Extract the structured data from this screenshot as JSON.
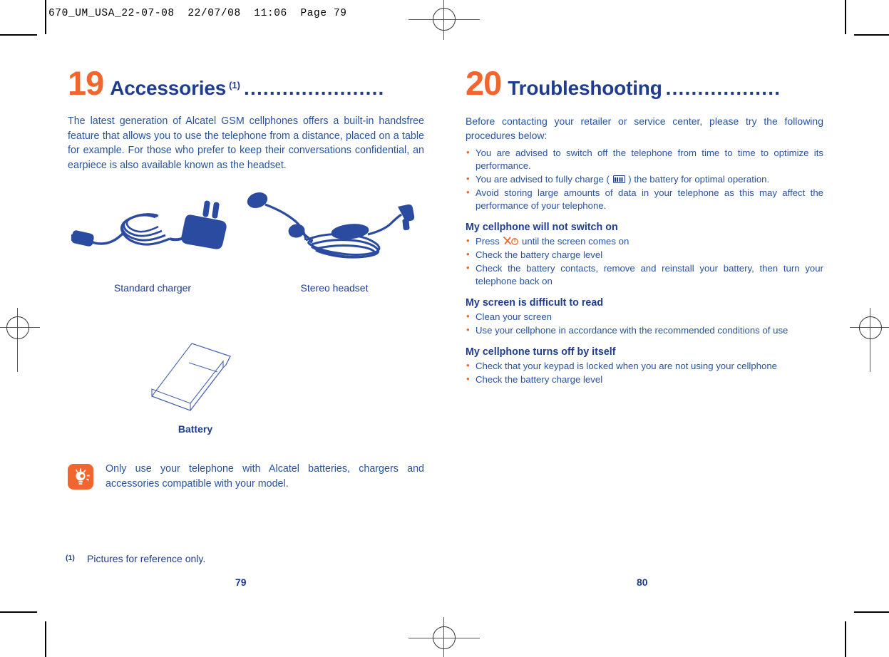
{
  "slug": "670_UM_USA_22-07-08  22/07/08  11:06  Page 79",
  "colors": {
    "orange": "#F0662E",
    "blue": "#1F3D8C",
    "body_blue": "#28539C"
  },
  "left_page": {
    "chapter": {
      "number": "19",
      "title": "Accessories",
      "superscript": "(1)",
      "dots": "......................"
    },
    "intro": "The latest generation of Alcatel GSM cellphones offers a built-in handsfree feature that allows you to use the telephone from a distance, placed on a table for example. For those who prefer to keep their conversations confidential, an earpiece is also available known as the headset.",
    "figures": [
      {
        "name": "standard-charger",
        "caption": "Standard charger"
      },
      {
        "name": "stereo-headset",
        "caption": "Stereo headset"
      },
      {
        "name": "battery",
        "caption": "Battery"
      }
    ],
    "note": {
      "icon": "lightbulb-tip-icon",
      "text": "Only use your telephone with Alcatel batteries, chargers and accessories compatible with your model."
    },
    "footnote": {
      "mark": "(1)",
      "text": "Pictures for reference only."
    },
    "page_number": "79"
  },
  "right_page": {
    "chapter": {
      "number": "20",
      "title": "Troubleshooting",
      "dots": ".................."
    },
    "intro": "Before contacting your retailer or service center, please try the following procedures below:",
    "general_bullets": [
      {
        "before": "You are advised to switch off the telephone from time to time to optimize its performance.",
        "icon": null,
        "after": ""
      },
      {
        "before": "You are advised to fully charge ( ",
        "icon": "battery-icon",
        "after": " ) the battery for optimal operation."
      },
      {
        "before": "Avoid storing large amounts of data in your telephone as this may affect the performance of your telephone.",
        "icon": null,
        "after": ""
      }
    ],
    "sections": [
      {
        "heading": "My cellphone will not switch on",
        "bullets": [
          {
            "before": "Press  ",
            "icon": "power-key-icon",
            "after": "  until the screen comes on"
          },
          {
            "before": "Check the battery charge level",
            "icon": null,
            "after": ""
          },
          {
            "before": "Check the battery contacts, remove and reinstall your battery, then turn your telephone back on",
            "icon": null,
            "after": ""
          }
        ]
      },
      {
        "heading": "My screen is difficult to read",
        "bullets": [
          {
            "before": "Clean your screen",
            "icon": null,
            "after": ""
          },
          {
            "before": "Use your cellphone in accordance with the recommended conditions of use",
            "icon": null,
            "after": ""
          }
        ]
      },
      {
        "heading": "My cellphone turns off by itself",
        "bullets": [
          {
            "before": "Check that your keypad is locked when you are not using your cellphone",
            "icon": null,
            "after": ""
          },
          {
            "before": "Check the battery charge level",
            "icon": null,
            "after": ""
          }
        ]
      }
    ],
    "page_number": "80"
  }
}
